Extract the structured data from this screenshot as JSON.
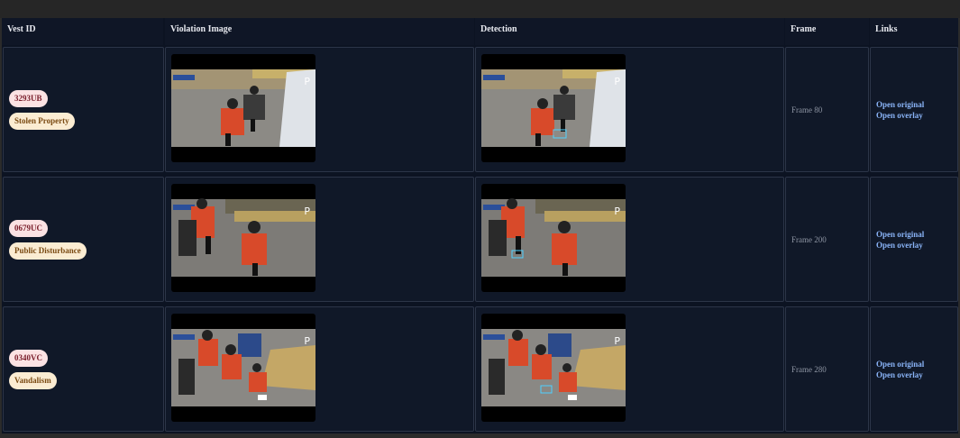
{
  "headers": {
    "vest_id": "Vest ID",
    "violation_image": "Violation Image",
    "detection": "Detection",
    "frame": "Frame",
    "links": "Links"
  },
  "rows": [
    {
      "vest_id": "3293UB",
      "violation": "Stolen Property",
      "frame": "Frame 80",
      "link_original": "Open original",
      "link_overlay": "Open overlay"
    },
    {
      "vest_id": "0679UC",
      "violation": "Public Disturbance",
      "frame": "Frame 200",
      "link_original": "Open original",
      "link_overlay": "Open overlay"
    },
    {
      "vest_id": "0340VC",
      "violation": "Vandalism",
      "frame": "Frame 280",
      "link_original": "Open original",
      "link_overlay": "Open overlay"
    }
  ],
  "colors": {
    "background": "#0c1322",
    "badge_id_bg": "#fbe2e3",
    "badge_type_bg": "#fbecd2",
    "link": "#8ab4f8"
  }
}
